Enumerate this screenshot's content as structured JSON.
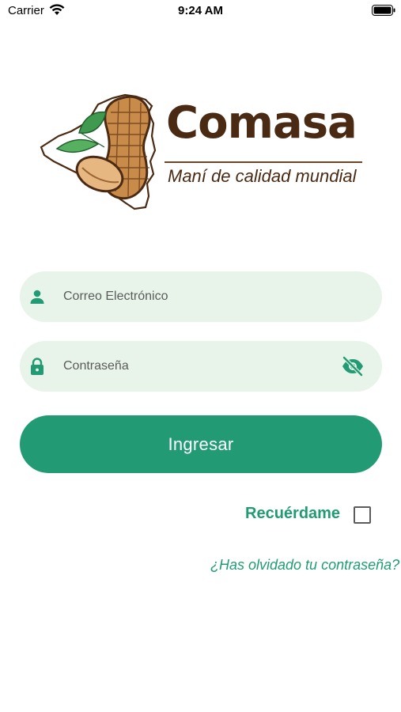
{
  "status_bar": {
    "carrier": "Carrier",
    "time": "9:24 AM"
  },
  "brand": {
    "name": "Comasa",
    "tagline": "Maní de calidad mundial"
  },
  "form": {
    "email_placeholder": "Correo Electrónico",
    "email_value": "",
    "password_placeholder": "Contraseña",
    "password_value": "",
    "submit_label": "Ingresar",
    "remember_label": "Recuérdame",
    "remember_checked": false,
    "forgot_label": "¿Has olvidado tu contraseña?"
  },
  "icons": {
    "email": "person-icon",
    "password": "lock-icon",
    "visibility": "eye-off-icon"
  },
  "colors": {
    "accent": "#229b75",
    "field_bg": "#e8f4ea",
    "brand_brown": "#4a2a12",
    "peanut": "#c98b4a",
    "leaf": "#3f9a4f"
  }
}
